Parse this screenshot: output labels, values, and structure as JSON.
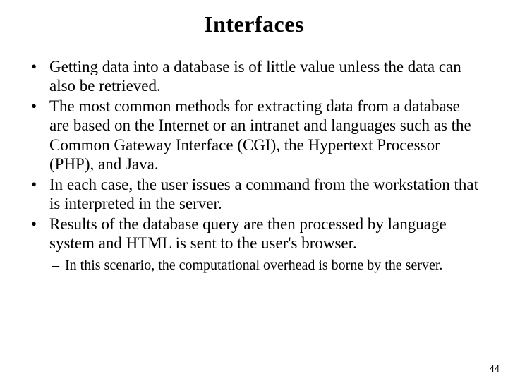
{
  "title": "Interfaces",
  "bullets": [
    "Getting data into a database is of little value unless the data can also be retrieved.",
    "The most common methods for extracting data from a database are based on the Internet or an intranet and languages such as the Common Gateway Interface (CGI), the Hypertext Processor (PHP), and Java.",
    "In each case, the user issues a command from the workstation that is interpreted in the server.",
    "Results of the database query are then processed by language system and HTML is sent to the user's browser."
  ],
  "subbullets": [
    "In this scenario, the computational overhead is borne by the server."
  ],
  "page_number": "44"
}
